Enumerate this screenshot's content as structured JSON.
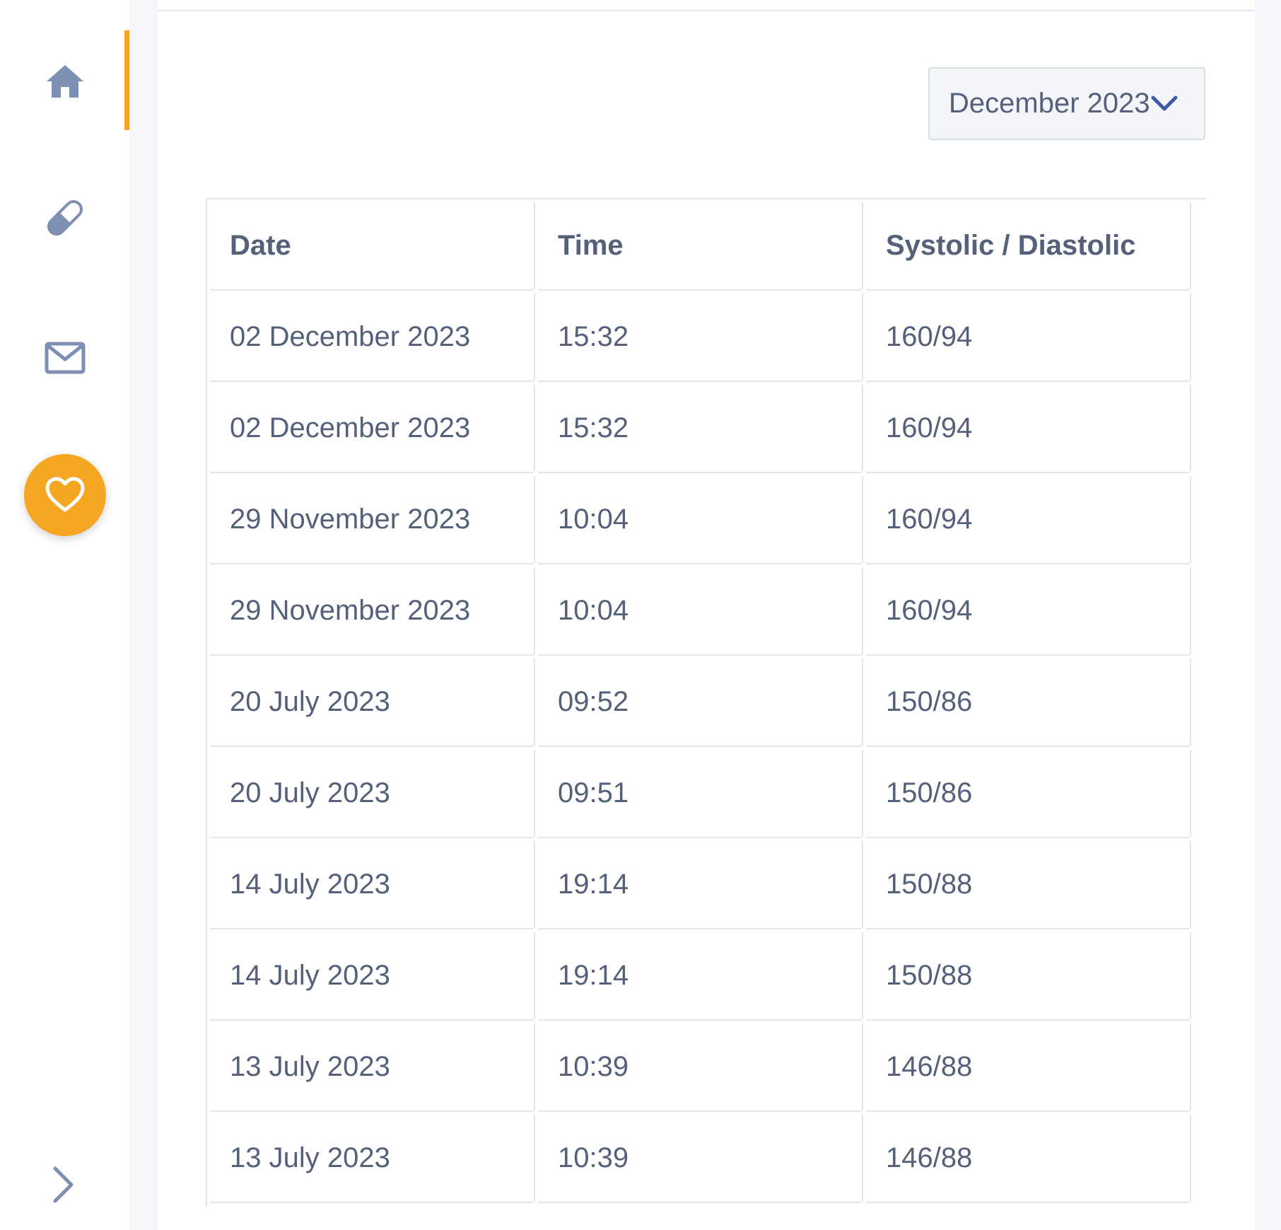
{
  "colors": {
    "accent": "#f5a623",
    "icon": "#7d8fb3",
    "text": "#55617a",
    "chevron": "#3f5aa8"
  },
  "sidebar": {
    "items": [
      {
        "name": "home",
        "icon": "home-icon",
        "active": true
      },
      {
        "name": "medication",
        "icon": "pill-icon"
      },
      {
        "name": "messages",
        "icon": "envelope-icon"
      },
      {
        "name": "health",
        "icon": "heart-icon",
        "highlighted": true
      }
    ],
    "expand_icon": "chevron-right-icon"
  },
  "filter": {
    "selected_month": "December 2023",
    "icon": "chevron-down-icon"
  },
  "table": {
    "headers": [
      "Date",
      "Time",
      "Systolic / Diastolic"
    ],
    "rows": [
      [
        "02 December 2023",
        "15:32",
        "160/94"
      ],
      [
        "02 December 2023",
        "15:32",
        "160/94"
      ],
      [
        "29 November 2023",
        "10:04",
        "160/94"
      ],
      [
        "29 November 2023",
        "10:04",
        "160/94"
      ],
      [
        "20 July 2023",
        "09:52",
        "150/86"
      ],
      [
        "20 July 2023",
        "09:51",
        "150/86"
      ],
      [
        "14 July 2023",
        "19:14",
        "150/88"
      ],
      [
        "14 July 2023",
        "19:14",
        "150/88"
      ],
      [
        "13 July 2023",
        "10:39",
        "146/88"
      ],
      [
        "13 July 2023",
        "10:39",
        "146/88"
      ]
    ]
  }
}
